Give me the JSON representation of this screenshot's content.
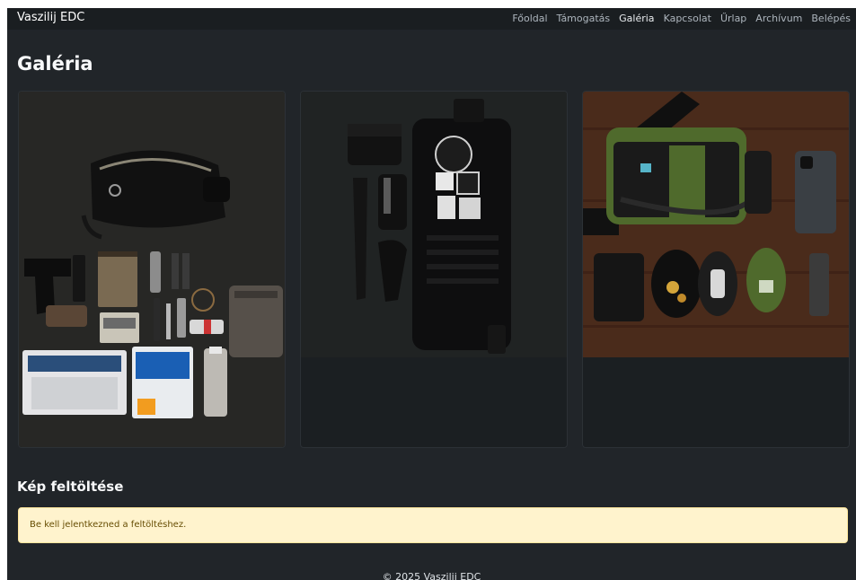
{
  "navbar": {
    "brand": "Vaszilij EDC",
    "links": [
      {
        "label": "Főoldal"
      },
      {
        "label": "Támogatás"
      },
      {
        "label": "Galéria"
      },
      {
        "label": "Kapcsolat"
      },
      {
        "label": "Űrlap"
      },
      {
        "label": "Archívum"
      },
      {
        "label": "Belépés"
      }
    ]
  },
  "page_title": "Galéria",
  "upload": {
    "heading": "Kép feltöltése",
    "login_required": "Be kell jelentkezned a feltöltéshez."
  },
  "footer": "© 2025 Vaszilij EDC",
  "colors": {
    "page_bg": "#212529",
    "navbar_bg": "#1a1e21",
    "alert_bg": "#fff3cd",
    "alert_text": "#664d03",
    "bag_olive": "#4f6a2c"
  }
}
